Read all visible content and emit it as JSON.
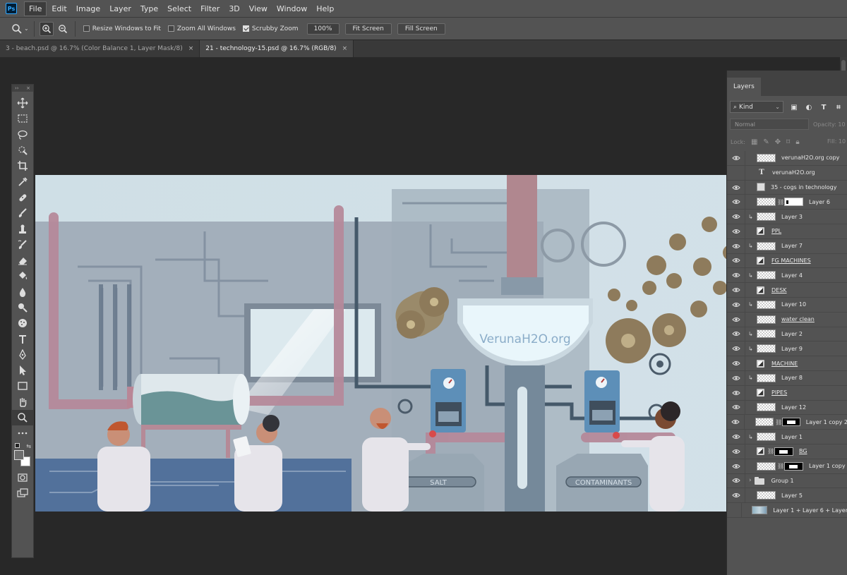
{
  "menu": {
    "logo": "Ps",
    "items": [
      "File",
      "Edit",
      "Image",
      "Layer",
      "Type",
      "Select",
      "Filter",
      "3D",
      "View",
      "Window",
      "Help"
    ],
    "active_index": 0
  },
  "options": {
    "resize_windows": {
      "label": "Resize Windows to Fit",
      "checked": false
    },
    "zoom_all": {
      "label": "Zoom All Windows",
      "checked": false
    },
    "scrubby": {
      "label": "Scrubby Zoom",
      "checked": true
    },
    "percent": "100%",
    "fit_screen": "Fit Screen",
    "fill_screen": "Fill Screen"
  },
  "tabs": [
    {
      "title": "3 - beach.psd @ 16.7% (Color Balance 1, Layer Mask/8)",
      "close": "×",
      "active": false
    },
    {
      "title": "21 - technology-15.psd @ 16.7% (RGB/8)",
      "close": "×",
      "active": true
    }
  ],
  "artwork": {
    "watermark": "VerunaH2O.org",
    "tank_labels": {
      "salt": "SALT",
      "contaminants": "CONTAMINANTS"
    },
    "colors": {
      "background": "#c9d9e0",
      "wall": "#9eabb7",
      "pipe": "#b58a97",
      "floor": "#4b6b94",
      "gear": "#8d7a5a"
    }
  },
  "tools": {
    "header_left": "››",
    "header_right": "×",
    "items": [
      "move",
      "marquee",
      "lasso",
      "quick-select",
      "crop",
      "eyedropper",
      "healing-brush",
      "brush",
      "clone-stamp",
      "history-brush",
      "eraser",
      "paint-bucket",
      "blur",
      "dodge",
      "sponge",
      "type",
      "pen",
      "path-select",
      "rectangle",
      "hand",
      "zoom",
      "more",
      "quick-mask",
      "screen-mode"
    ],
    "active": "zoom"
  },
  "layers_panel": {
    "tab": "Layers",
    "filter": "Kind",
    "blend_mode": "Normal",
    "opacity_label": "Opacity: 10",
    "lock_label": "Lock:",
    "fill_label": "Fill: 10",
    "layers": [
      {
        "name": "verunaH2O.org copy",
        "visible": true,
        "kind": "pixel"
      },
      {
        "name": "verunaH2O.org",
        "visible": false,
        "kind": "text"
      },
      {
        "name": "35 - cogs in technology",
        "visible": true,
        "kind": "smart"
      },
      {
        "name": "Layer 6",
        "visible": true,
        "kind": "pixel",
        "mask": "white"
      },
      {
        "name": "Layer 3",
        "visible": true,
        "kind": "pixel",
        "clipped": true
      },
      {
        "name": "PPL",
        "visible": true,
        "kind": "adjust",
        "underline": true
      },
      {
        "name": "Layer 7",
        "visible": true,
        "kind": "pixel",
        "clipped": true
      },
      {
        "name": "FG MACHINES",
        "visible": true,
        "kind": "adjust",
        "underline": true
      },
      {
        "name": "Layer 4",
        "visible": true,
        "kind": "pixel",
        "clipped": true
      },
      {
        "name": "DESK",
        "visible": true,
        "kind": "adjust",
        "underline": true
      },
      {
        "name": "Layer 10",
        "visible": true,
        "kind": "pixel",
        "clipped": true
      },
      {
        "name": "water clean",
        "visible": true,
        "kind": "pixel",
        "underline": true
      },
      {
        "name": "Layer 2",
        "visible": true,
        "kind": "pixel",
        "clipped": true
      },
      {
        "name": "Layer 9",
        "visible": true,
        "kind": "pixel",
        "clipped": true
      },
      {
        "name": "MACHINE",
        "visible": true,
        "kind": "adjust",
        "underline": true
      },
      {
        "name": "Layer 8",
        "visible": true,
        "kind": "pixel",
        "clipped": true
      },
      {
        "name": "PIPES",
        "visible": true,
        "kind": "adjust",
        "underline": true
      },
      {
        "name": "Layer 12",
        "visible": true,
        "kind": "pixel"
      },
      {
        "name": "Layer 1 copy 2",
        "visible": true,
        "kind": "pixel",
        "mask": "black"
      },
      {
        "name": "Layer 1",
        "visible": true,
        "kind": "pixel",
        "clipped": true
      },
      {
        "name": "BG",
        "visible": true,
        "kind": "adjust",
        "mask": "black",
        "underline": true
      },
      {
        "name": "Layer 1 copy",
        "visible": true,
        "kind": "pixel",
        "mask": "black"
      },
      {
        "name": "Group 1",
        "visible": true,
        "kind": "group"
      },
      {
        "name": "Layer 5",
        "visible": true,
        "kind": "pixel"
      },
      {
        "name": "Layer 1 + Layer 6 + Layer",
        "visible": false,
        "kind": "image"
      }
    ]
  }
}
